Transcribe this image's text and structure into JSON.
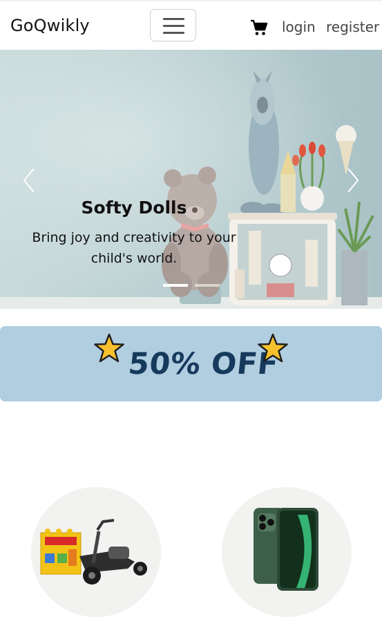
{
  "navbar": {
    "brand": "GoQwikly",
    "menu_icon": "hamburger-icon",
    "cart_icon": "cart-icon",
    "links": [
      "login",
      "register"
    ]
  },
  "carousel": {
    "slide": {
      "title": "Softy Dolls",
      "text": "Bring joy and creativity to your child's world."
    },
    "active_index": 0,
    "indicator_count": 2,
    "prev_icon": "chevron-left-icon",
    "next_icon": "chevron-right-icon"
  },
  "promo": {
    "text": "50% OFF",
    "icon": "star-icon",
    "background_color": "#b1cde0",
    "text_color": "#163a5c"
  },
  "products": [
    {
      "image": "toy-go-kart-and-lego-box"
    },
    {
      "image": "green-smartphone"
    }
  ]
}
